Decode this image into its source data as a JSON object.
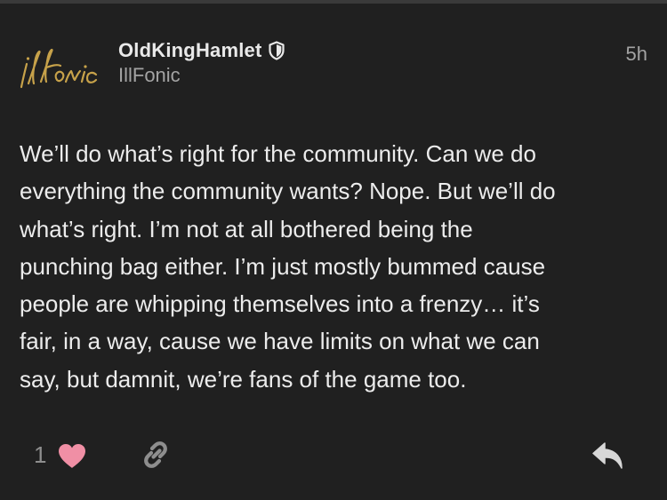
{
  "post": {
    "author": {
      "username": "OldKingHamlet",
      "group": "IllFonic",
      "avatar_logo_text": "illfonic",
      "badge_icon": "shield-icon"
    },
    "time_ago": "5h",
    "body": "We’ll do what’s right for the community. Can we do\neverything the community wants? Nope. But we’ll do\nwhat’s right. I’m not at all bothered being the\npunching bag either. I’m just mostly bummed cause\npeople are whipping themselves into a frenzy… it’s\nfair, in a way, cause we have limits on what we can\nsay, but damnit, we’re fans of the game too.",
    "actions": {
      "like_count": "1",
      "like_icon": "heart-icon",
      "link_icon": "link-icon",
      "reply_icon": "reply-icon"
    }
  },
  "colors": {
    "background": "#202020",
    "heart": "#f08fa5",
    "muted_text": "#a3a3a3",
    "avatar_gold": "#c7a24a"
  }
}
